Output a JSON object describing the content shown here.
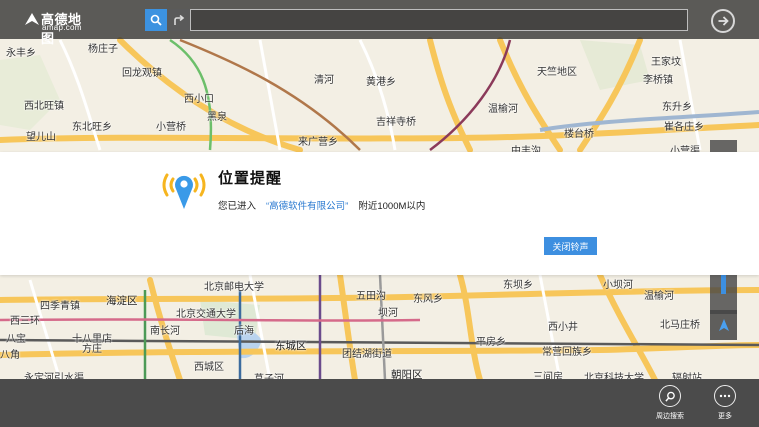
{
  "app": {
    "logo_main": "高德地图",
    "logo_sub": "amap.com"
  },
  "search": {
    "placeholder": "",
    "value": ""
  },
  "icons": {
    "search": "search-icon",
    "route": "route-icon",
    "go": "arrow-right-circle-icon",
    "location_alert": "location-pin-signal-icon",
    "compass": "navigation-arrow-icon",
    "nearby": "search-icon",
    "more": "more-dots-icon"
  },
  "notification": {
    "title": "位置提醒",
    "message_prefix": "您已进入",
    "company": "“高德软件有限公司”",
    "message_suffix": "附近1000M以内",
    "close_label": "关闭铃声"
  },
  "appbar": {
    "nearby_label": "周边搜索",
    "more_label": "更多"
  },
  "map_labels_top": [
    "永丰乡",
    "杨庄子",
    "回龙观镇",
    "西北旺镇",
    "西小口",
    "清河",
    "黄港乡",
    "天竺地区",
    "王家坟",
    "李桥镇",
    "东北旺乡",
    "小营桥",
    "黑泉",
    "吉祥寺桥",
    "温榆河",
    "望儿山",
    "东升乡",
    "崔各庄乡",
    "楼台桥",
    "来广营乡",
    "中丰沟",
    "小营渠"
  ],
  "map_labels_bottom": [
    "北京邮电大学",
    "四季青镇",
    "海淀区",
    "北京交通大学",
    "五田沟",
    "东风乡",
    "东坝乡",
    "小坝河",
    "温榆河",
    "西三环",
    "坝河",
    "北马庄桥",
    "八宝",
    "南长河",
    "后海",
    "东城区",
    "十八里店",
    "西小井",
    "北马庄桥",
    "方庄",
    "八角",
    "西城区",
    "团结湖街道",
    "平房乡",
    "常营回族乡",
    "永定河引水渠",
    "菖子河",
    "朝阳区",
    "三间房",
    "北京科技大学",
    "辐射站"
  ],
  "colors": {
    "accent": "#3d8fe0",
    "topbar": "#303030",
    "appbar": "#4b4b4b",
    "map_bg": "#f3efe4",
    "road_major": "#f7c65a",
    "company_text": "#2b7ad0"
  }
}
